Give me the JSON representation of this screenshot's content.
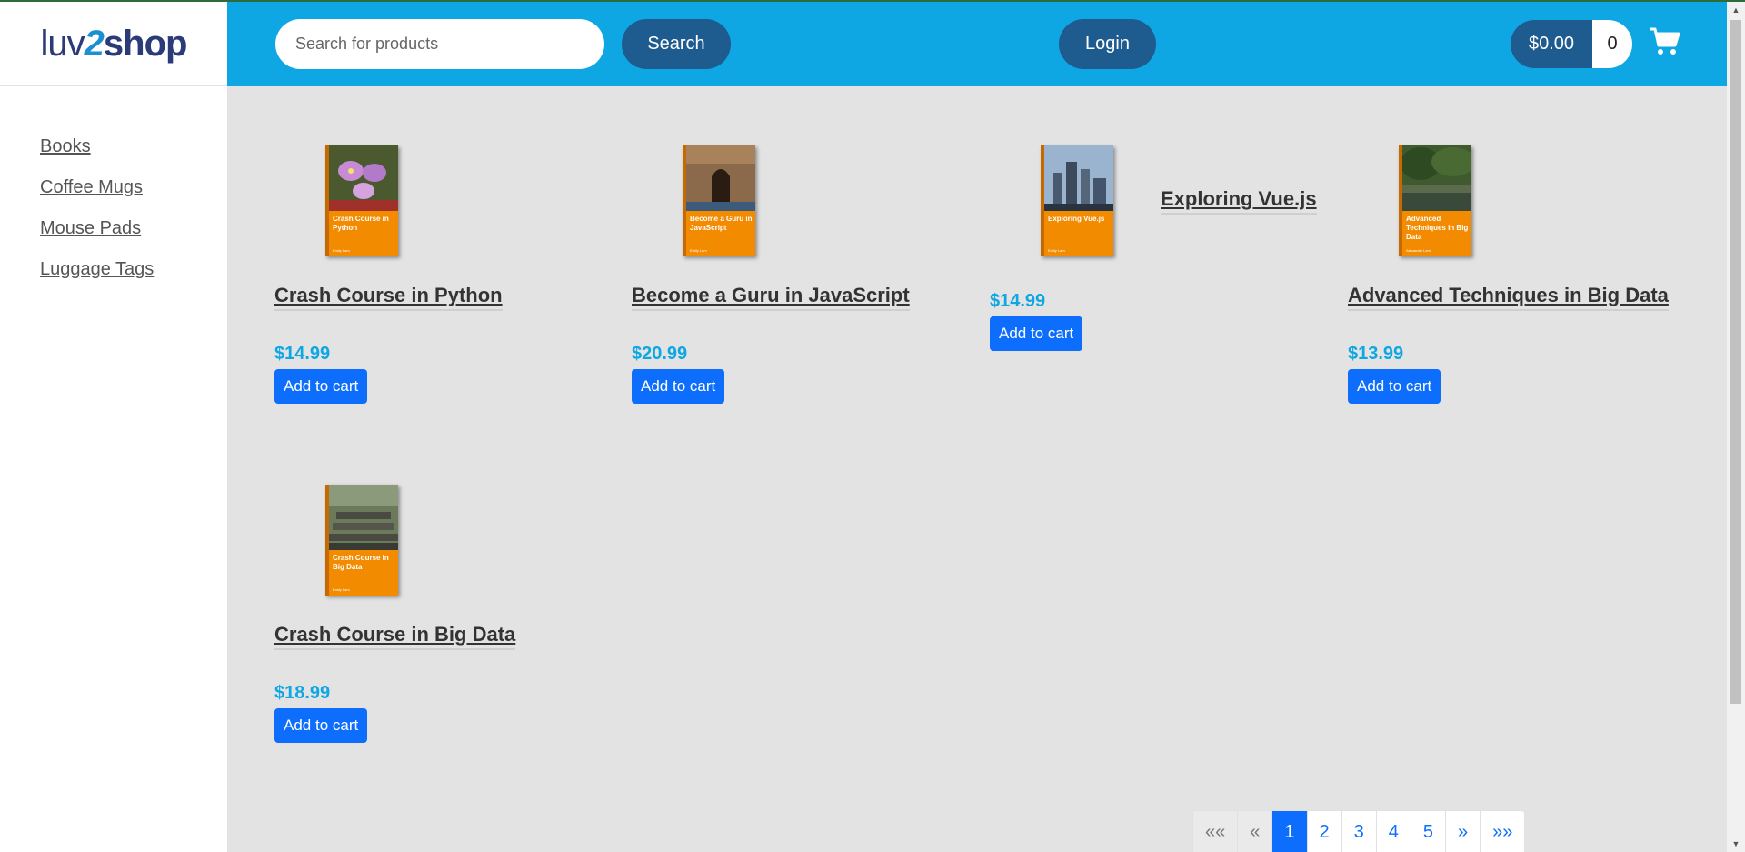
{
  "brand": {
    "logo_text_a": "luv",
    "logo_text_b": "2",
    "logo_text_c": "shop"
  },
  "sidebar": {
    "items": [
      {
        "label": "Books"
      },
      {
        "label": "Coffee Mugs"
      },
      {
        "label": "Mouse Pads"
      },
      {
        "label": "Luggage Tags"
      }
    ]
  },
  "header": {
    "search_placeholder": "Search for products",
    "search_label": "Search",
    "login_label": "Login",
    "cart_total": "$0.00",
    "cart_quantity": "0",
    "cart_icon": "shopping-cart-icon"
  },
  "colors": {
    "header_bg": "#0ea7e3",
    "dark_button": "#1e5b8f",
    "price": "#0ea7e3",
    "primary": "#0d6efd",
    "cover_orange": "#f28b00"
  },
  "products": [
    {
      "name": "Crash Course in Python",
      "price": "$14.99",
      "cover_title": "Crash Course in Python",
      "cover_author": "Emily Lam",
      "add_label": "Add to cart"
    },
    {
      "name": "Become a Guru in JavaScript",
      "price": "$20.99",
      "cover_title": "Become a Guru in JavaScript",
      "cover_author": "Emily Lam",
      "add_label": "Add to cart"
    },
    {
      "name": "Exploring Vue.js",
      "price": "$14.99",
      "cover_title": "Exploring Vue.js",
      "cover_author": "Emily Lam",
      "add_label": "Add to cart"
    },
    {
      "name": "Advanced Techniques in Big Data",
      "price": "$13.99",
      "cover_title": "Advanced Techniques in Big Data",
      "cover_author": "Alexander Lam",
      "add_label": "Add to cart"
    },
    {
      "name": "Crash Course in Big Data",
      "price": "$18.99",
      "cover_title": "Crash Course in Big Data",
      "cover_author": "Emily Lam",
      "add_label": "Add to cart"
    }
  ],
  "pagination": {
    "first": "««",
    "prev": "«",
    "pages": [
      "1",
      "2",
      "3",
      "4",
      "5"
    ],
    "active_page": "1",
    "next": "»",
    "last": "»»"
  }
}
